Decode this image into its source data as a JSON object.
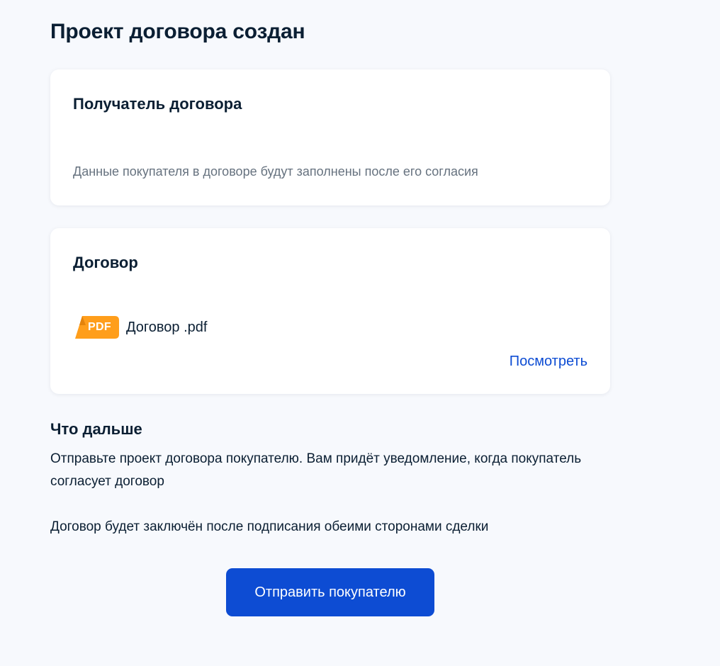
{
  "page": {
    "title": "Проект договора создан"
  },
  "recipient_card": {
    "title": "Получатель договора",
    "note": "Данные покупателя в договоре будут заполнены после его согласия"
  },
  "contract_card": {
    "title": "Договор",
    "file": {
      "type_badge": "PDF",
      "name": "Договор .pdf",
      "icon": "pdf-file-icon",
      "badge_color": "#ff9e1b"
    },
    "view_link": "Посмотреть"
  },
  "next_steps": {
    "title": "Что дальше",
    "paragraph_1": "Отправьте проект договора покупателю. Вам придёт уведомление, когда покупатель согласует договор",
    "paragraph_2": "Договор будет заключён после подписания обеими сторонами сделки"
  },
  "actions": {
    "send_button": "Отправить покупателю"
  },
  "colors": {
    "background": "#f7f9fd",
    "text": "#0b1f33",
    "secondary_text": "#66727f",
    "accent": "#0d4cd3"
  }
}
